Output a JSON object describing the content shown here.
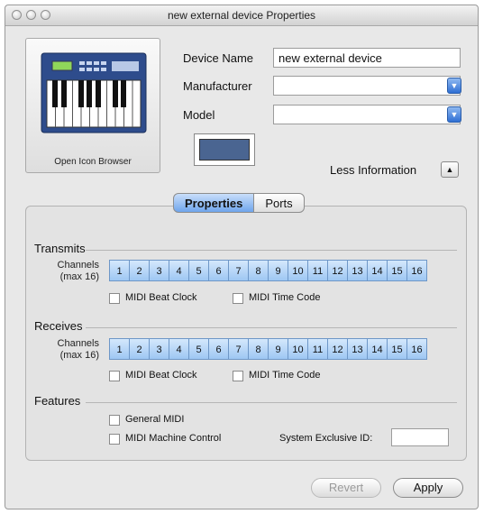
{
  "window": {
    "title": "new external device Properties"
  },
  "icon_panel": {
    "label": "Open Icon Browser",
    "icon": "midi-keyboard-icon"
  },
  "device": {
    "name_label": "Device Name",
    "name_value": "new external device",
    "manufacturer_label": "Manufacturer",
    "manufacturer_value": "",
    "model_label": "Model",
    "model_value": ""
  },
  "less_info": {
    "label": "Less Information",
    "icon": "triangle-up-icon"
  },
  "tabs": [
    {
      "label": "Properties",
      "selected": true
    },
    {
      "label": "Ports",
      "selected": false
    }
  ],
  "transmits": {
    "title": "Transmits",
    "channels_label": "Channels (max 16)",
    "channels": [
      "1",
      "2",
      "3",
      "4",
      "5",
      "6",
      "7",
      "8",
      "9",
      "10",
      "11",
      "12",
      "13",
      "14",
      "15",
      "16"
    ],
    "beat_clock_label": "MIDI Beat Clock",
    "time_code_label": "MIDI Time Code"
  },
  "receives": {
    "title": "Receives",
    "channels_label": "Channels (max 16)",
    "channels": [
      "1",
      "2",
      "3",
      "4",
      "5",
      "6",
      "7",
      "8",
      "9",
      "10",
      "11",
      "12",
      "13",
      "14",
      "15",
      "16"
    ],
    "beat_clock_label": "MIDI Beat Clock",
    "time_code_label": "MIDI Time Code"
  },
  "features": {
    "title": "Features",
    "general_midi_label": "General MIDI",
    "machine_control_label": "MIDI Machine Control",
    "sysex_label": "System Exclusive ID:",
    "sysex_value": ""
  },
  "buttons": {
    "revert": "Revert",
    "apply": "Apply"
  },
  "colors": {
    "accent": "#6fa5ec",
    "channel_fill": "#9ec7f3",
    "swatch": "#4a6591"
  }
}
